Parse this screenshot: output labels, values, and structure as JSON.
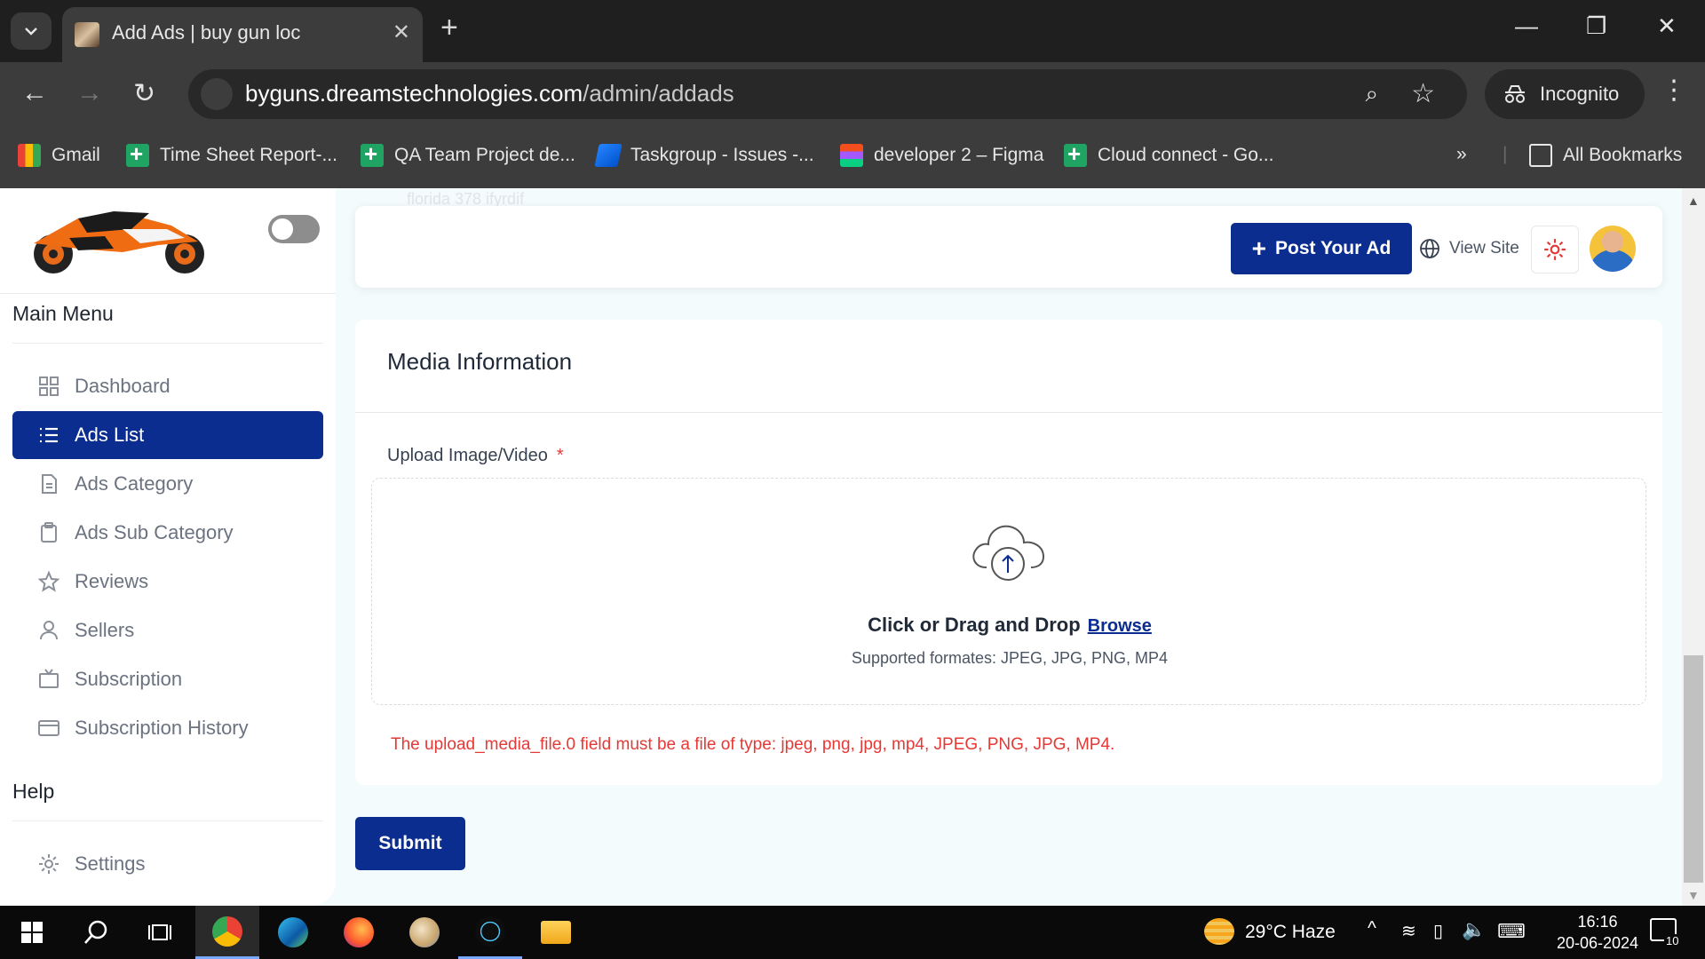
{
  "browser": {
    "tab_title": "Add Ads | buy gun loc",
    "url_host": "byguns.dreamstechnologies.com",
    "url_path": "/admin/addads",
    "incognito_label": "Incognito",
    "bookmarks": [
      {
        "label": "Gmail",
        "icon": "gmail-icon"
      },
      {
        "label": "Time Sheet Report-...",
        "icon": "sheets-icon"
      },
      {
        "label": "QA Team Project de...",
        "icon": "sheets-icon"
      },
      {
        "label": "Taskgroup - Issues -...",
        "icon": "jira-icon"
      },
      {
        "label": "developer 2 – Figma",
        "icon": "figma-icon"
      },
      {
        "label": "Cloud connect - Go...",
        "icon": "sheets-icon"
      }
    ],
    "all_bookmarks_label": "All Bookmarks"
  },
  "sidebar": {
    "main_menu_title": "Main Menu",
    "items": [
      {
        "label": "Dashboard",
        "icon": "grid-icon",
        "active": false
      },
      {
        "label": "Ads List",
        "icon": "list-icon",
        "active": true
      },
      {
        "label": "Ads Category",
        "icon": "document-icon",
        "active": false
      },
      {
        "label": "Ads Sub Category",
        "icon": "clipboard-icon",
        "active": false
      },
      {
        "label": "Reviews",
        "icon": "star-icon",
        "active": false
      },
      {
        "label": "Sellers",
        "icon": "user-icon",
        "active": false
      },
      {
        "label": "Subscription",
        "icon": "tv-icon",
        "active": false
      },
      {
        "label": "Subscription History",
        "icon": "card-icon",
        "active": false
      }
    ],
    "help_title": "Help",
    "help_items": [
      {
        "label": "Settings",
        "icon": "gear-icon"
      }
    ]
  },
  "header": {
    "ghost_text": "florida 378 ifyrdif",
    "post_ad_label": "Post Your Ad",
    "view_site_label": "View Site"
  },
  "media": {
    "title": "Media Information",
    "upload_label": "Upload Image/Video",
    "required_mark": "*",
    "drop_text": "Click or Drag and Drop",
    "browse_label": "Browse",
    "formats_text": "Supported formates: JPEG, JPG, PNG, MP4",
    "error_text": "The upload_media_file.0 field must be a file of type: jpeg, png, jpg, mp4, JPEG, PNG, JPG, MP4."
  },
  "form": {
    "submit_label": "Submit"
  },
  "taskbar": {
    "weather": "29°C  Haze",
    "time": "16:16",
    "date": "20-06-2024",
    "notifications": "10"
  },
  "colors": {
    "primary": "#0b2d8f",
    "error": "#e53935",
    "page_bg": "#f3fbfc"
  }
}
